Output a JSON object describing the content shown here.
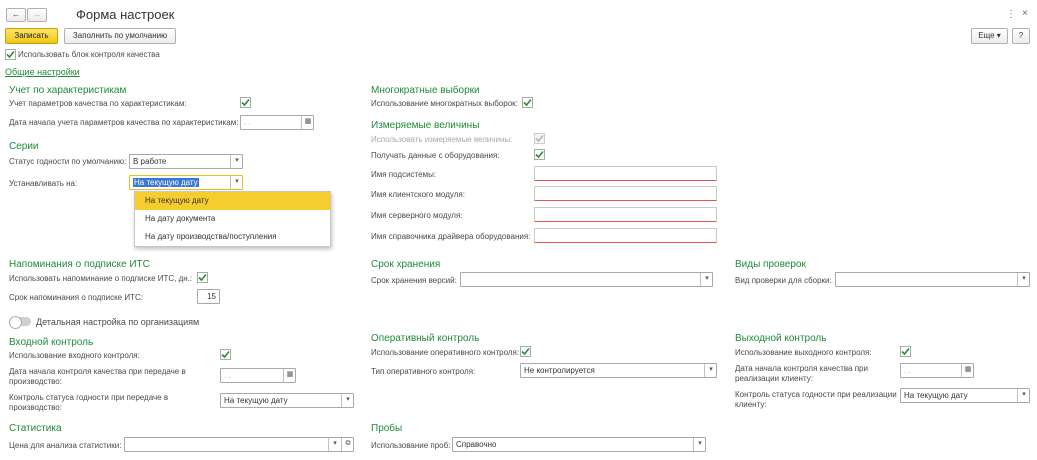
{
  "window": {
    "title": "Форма настроек",
    "back_icon": "←",
    "forward_icon": "→",
    "menu_icon": "⋮",
    "close_icon": "×"
  },
  "toolbar": {
    "save_label": "Записать",
    "defaults_label": "Заполнить по умолчанию",
    "more_label": "Еще",
    "help_label": "?"
  },
  "use_quality_block_label": "Использовать блок контроля качества",
  "general_link": "Общие настройки",
  "characteristics": {
    "title": "Учет по характеристикам",
    "params_label": "Учет параметров качества по характеристикам:",
    "start_date_label": "Дата начала учета параметров качества по характеристикам:",
    "start_date_value": " . .",
    "start_date_checked": true
  },
  "series": {
    "title": "Серии",
    "status_label": "Статус годности по умолчанию:",
    "status_value": "В работе",
    "set_on_label": "Устанавливать на:",
    "set_on_value": "На текущую дату",
    "options": [
      "На текущую дату",
      "На дату документа",
      "На дату производства/поступления"
    ]
  },
  "multi": {
    "title": "Многократные выборки",
    "use_label": "Использование многократных выборок:"
  },
  "measured": {
    "title": "Измеряемые величины",
    "use_label": "Использовать измеряемые величины:",
    "equipment_label": "Получать данные с оборудования:",
    "subsystem_label": "Имя подсистемы:",
    "client_module_label": "Имя клиентского модуля:",
    "server_module_label": "Имя серверного модуля:",
    "driver_label": "Имя справочника драйвера оборудования:"
  },
  "its": {
    "title": "Напоминания о подписке ИТС",
    "use_label": "Использовать напоминание о подписке ИТС, дн.:",
    "term_label": "Срок напоминания о подписке ИТС:",
    "term_value": "15"
  },
  "storage": {
    "title": "Срок хранения",
    "versions_label": "Срок хранения версий:"
  },
  "checks": {
    "title": "Виды проверок",
    "assembly_label": "Вид проверки для сборки:"
  },
  "org_toggle_label": "Детальная настройка по организациям",
  "incoming": {
    "title": "Входной контроль",
    "use_label": "Использование входного контроля:",
    "date_label_1": "Дата начала контроля качества при передаче в",
    "date_label_2": "производство:",
    "date_value": " . .",
    "status_label_1": "Контроль статуса годности при передаче в",
    "status_label_2": "производство:",
    "status_value": "На текущую дату"
  },
  "operative": {
    "title": "Оперативный контроль",
    "use_label": "Использование оперативного контроля:",
    "type_label": "Тип оперативного контроля:",
    "type_value": "Не контролируется"
  },
  "outgoing": {
    "title": "Выходной контроль",
    "use_label": "Использование выходного контроля:",
    "date_label_1": "Дата начала контроля качества при",
    "date_label_2": "реализации клиенту:",
    "date_value": " . .",
    "status_label_1": "Контроль статуса годности при реализации",
    "status_label_2": "клиенту:",
    "status_value": "На текущую дату"
  },
  "stats": {
    "title": "Статистика",
    "price_label": "Цена для анализа статистики:"
  },
  "samples": {
    "title": "Пробы",
    "use_label": "Использование проб:",
    "use_value": "Справочно"
  }
}
